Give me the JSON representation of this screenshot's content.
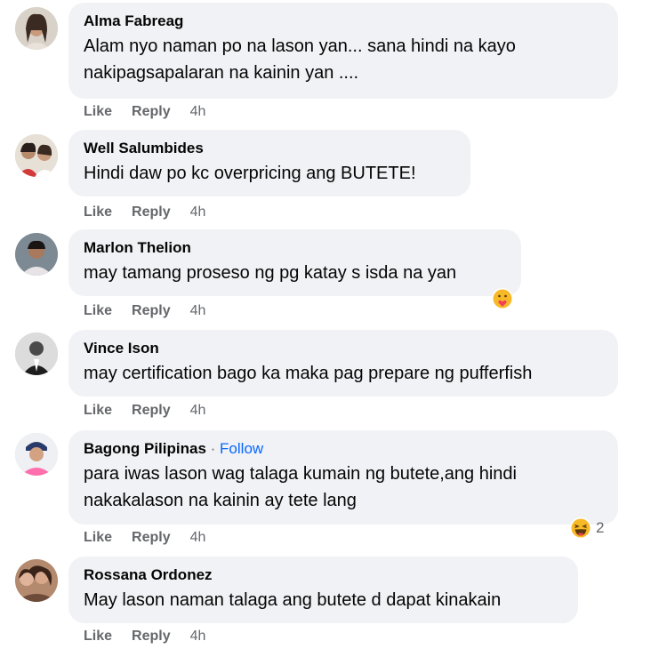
{
  "comments": [
    {
      "name": "Alma Fabreag",
      "lines": [
        "Alam nyo naman po na lason yan... sana hindi na kayo",
        "nakipagsapalaran na kainin yan ...."
      ],
      "like": "Like",
      "reply": "Reply",
      "time": "4h"
    },
    {
      "name": "Well Salumbides",
      "lines": [
        "Hindi daw po kc overpricing ang BUTETE!"
      ],
      "like": "Like",
      "reply": "Reply",
      "time": "4h"
    },
    {
      "name": "Marlon Thelion",
      "lines": [
        "may tamang proseso ng pg katay s isda na yan"
      ],
      "like": "Like",
      "reply": "Reply",
      "time": "4h",
      "reaction": {
        "icon": "care-emoji-icon"
      }
    },
    {
      "name": "Vince Ison",
      "lines": [
        "may certification bago ka maka pag prepare ng pufferfish"
      ],
      "like": "Like",
      "reply": "Reply",
      "time": "4h"
    },
    {
      "name": "Bagong Pilipinas",
      "separator": "·",
      "follow": "Follow",
      "lines": [
        "para iwas lason wag talaga kumain ng butete,ang hindi",
        "nakakalason na kainin ay tete lang"
      ],
      "like": "Like",
      "reply": "Reply",
      "time": "4h",
      "reaction": {
        "icon": "haha-emoji-icon",
        "count": "2"
      }
    },
    {
      "name": "Rossana Ordonez",
      "lines": [
        "May lason naman talaga ang butete d dapat kinakain"
      ],
      "like": "Like",
      "reply": "Reply",
      "time": "4h"
    }
  ]
}
